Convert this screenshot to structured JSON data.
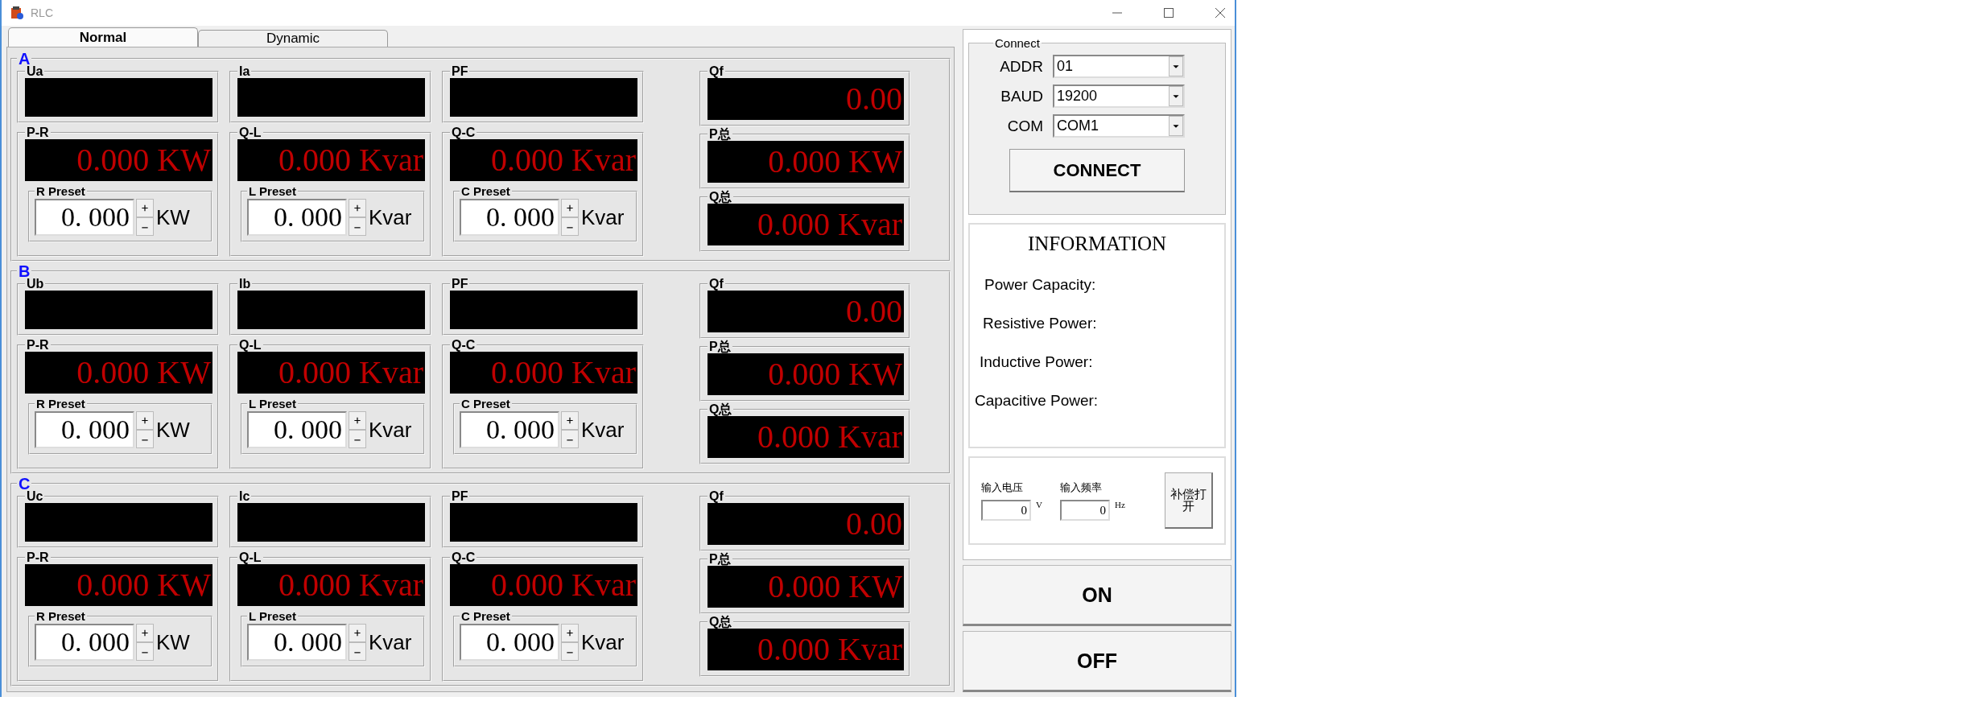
{
  "window": {
    "title": "RLC"
  },
  "tabs": [
    {
      "label": "Normal",
      "selected": true
    },
    {
      "label": "Dynamic",
      "selected": false
    }
  ],
  "phases": [
    {
      "name": "A",
      "displays": [
        {
          "label": "Ua"
        },
        {
          "label": "Ia"
        },
        {
          "label": "PF"
        }
      ],
      "power": [
        {
          "label": "P-R",
          "reading": "0.000 KW",
          "preset_label": "R Preset",
          "preset_value": "0. 000",
          "unit": "KW"
        },
        {
          "label": "Q-L",
          "reading": "0.000 Kvar",
          "preset_label": "L Preset",
          "preset_value": "0. 000",
          "unit": "Kvar"
        },
        {
          "label": "Q-C",
          "reading": "0.000 Kvar",
          "preset_label": "C Preset",
          "preset_value": "0. 000",
          "unit": "Kvar"
        }
      ],
      "totals": [
        {
          "label": "Qf",
          "reading": "0.00"
        },
        {
          "label": "P总",
          "reading": "0.000 KW"
        },
        {
          "label": "Q总",
          "reading": "0.000 Kvar"
        }
      ]
    },
    {
      "name": "B",
      "displays": [
        {
          "label": "Ub"
        },
        {
          "label": "Ib"
        },
        {
          "label": "PF"
        }
      ],
      "power": [
        {
          "label": "P-R",
          "reading": "0.000 KW",
          "preset_label": "R Preset",
          "preset_value": "0. 000",
          "unit": "KW"
        },
        {
          "label": "Q-L",
          "reading": "0.000 Kvar",
          "preset_label": "L Preset",
          "preset_value": "0. 000",
          "unit": "Kvar"
        },
        {
          "label": "Q-C",
          "reading": "0.000 Kvar",
          "preset_label": "C Preset",
          "preset_value": "0. 000",
          "unit": "Kvar"
        }
      ],
      "totals": [
        {
          "label": "Qf",
          "reading": "0.00"
        },
        {
          "label": "P总",
          "reading": "0.000 KW"
        },
        {
          "label": "Q总",
          "reading": "0.000 Kvar"
        }
      ]
    },
    {
      "name": "C",
      "displays": [
        {
          "label": "Uc"
        },
        {
          "label": "Ic"
        },
        {
          "label": "PF"
        }
      ],
      "power": [
        {
          "label": "P-R",
          "reading": "0.000 KW",
          "preset_label": "R Preset",
          "preset_value": "0. 000",
          "unit": "KW"
        },
        {
          "label": "Q-L",
          "reading": "0.000 Kvar",
          "preset_label": "L Preset",
          "preset_value": "0. 000",
          "unit": "Kvar"
        },
        {
          "label": "Q-C",
          "reading": "0.000 Kvar",
          "preset_label": "C Preset",
          "preset_value": "0. 000",
          "unit": "Kvar"
        }
      ],
      "totals": [
        {
          "label": "Qf",
          "reading": "0.00"
        },
        {
          "label": "P总",
          "reading": "0.000 KW"
        },
        {
          "label": "Q总",
          "reading": "0.000 Kvar"
        }
      ]
    }
  ],
  "connect": {
    "title": "Connect",
    "fields": [
      {
        "label": "ADDR",
        "value": "01"
      },
      {
        "label": "BAUD",
        "value": "19200"
      },
      {
        "label": "COM",
        "value": "COM1"
      }
    ],
    "button": "CONNECT"
  },
  "information": {
    "title": "INFORMATION",
    "lines": [
      "Power Capacity:",
      "Resistive Power:",
      "Inductive Power:",
      "Capacitive Power:"
    ]
  },
  "compensation": {
    "inputs": [
      {
        "label": "输入电压",
        "value": "0",
        "unit": "V"
      },
      {
        "label": "输入频率",
        "value": "0",
        "unit": "Hz"
      }
    ],
    "button": "补偿打开"
  },
  "power_buttons": [
    "ON",
    "OFF"
  ]
}
